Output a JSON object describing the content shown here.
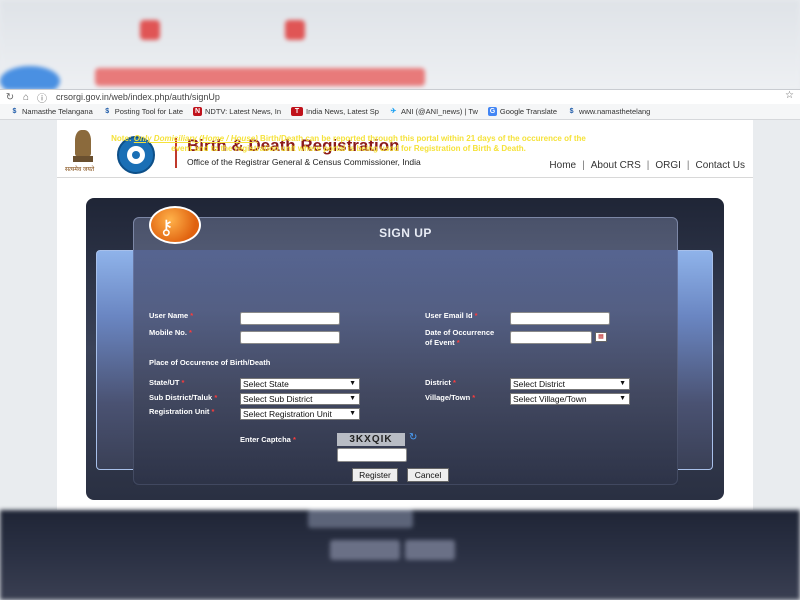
{
  "browser": {
    "url": "crsorgi.gov.in/web/index.php/auth/signUp",
    "bookmarks": [
      {
        "label": "Namasthe Telangana",
        "icon": "namasthe-icon",
        "color": "#1d5aa8"
      },
      {
        "label": "Posting Tool for Late",
        "icon": "namasthe-icon",
        "color": "#1d5aa8"
      },
      {
        "label": "NDTV: Latest News, In",
        "icon": "ndtv-icon",
        "color": "#c0121b"
      },
      {
        "label": "India News, Latest Sp",
        "icon": "toi-icon",
        "color": "#c0121b"
      },
      {
        "label": "ANI (@ANI_news) | Tw",
        "icon": "twitter-icon",
        "color": "#1da1f2"
      },
      {
        "label": "Google Translate",
        "icon": "translate-icon",
        "color": "#4285f4"
      },
      {
        "label": "www.namasthetelang",
        "icon": "namasthe-icon",
        "color": "#1d5aa8"
      }
    ]
  },
  "header": {
    "emblem_text": "सत्यमेव जयते",
    "title": "Birth & Death Registration",
    "subtitle": "Office of the Registrar General & Census Commissioner, India",
    "nav": [
      "Home",
      "About CRS",
      "ORGI",
      "Contact Us"
    ]
  },
  "signup": {
    "title": "SIGN UP",
    "note_prefix": "Note: ",
    "note_emphasis": "Only Domiciliary (Home / House)",
    "note_rest": " Birth/Death can be reported through this portal within 21 days of the occurence of the event and to the registration unit where portal is being used for Registration of Birth & Death.",
    "labels": {
      "user_name": "User Name",
      "mobile": "Mobile No.",
      "email": "User Email Id",
      "date_line1": "Date of Occurrence",
      "date_line2": "of Event",
      "place": "Place of Occurence of Birth/Death",
      "state": "State/UT",
      "district": "District",
      "sub_district": "Sub District/Taluk",
      "village": "Village/Town",
      "reg_unit": "Registration Unit",
      "captcha": "Enter Captcha"
    },
    "required_mark": "*",
    "selects": {
      "state": "Select State",
      "district": "Select District",
      "sub_district": "Select Sub District",
      "village": "Select Village/Town",
      "reg_unit": "Select Registration Unit"
    },
    "captcha_text": "3KXQIK",
    "register_label": "Register",
    "cancel_label": "Cancel"
  }
}
